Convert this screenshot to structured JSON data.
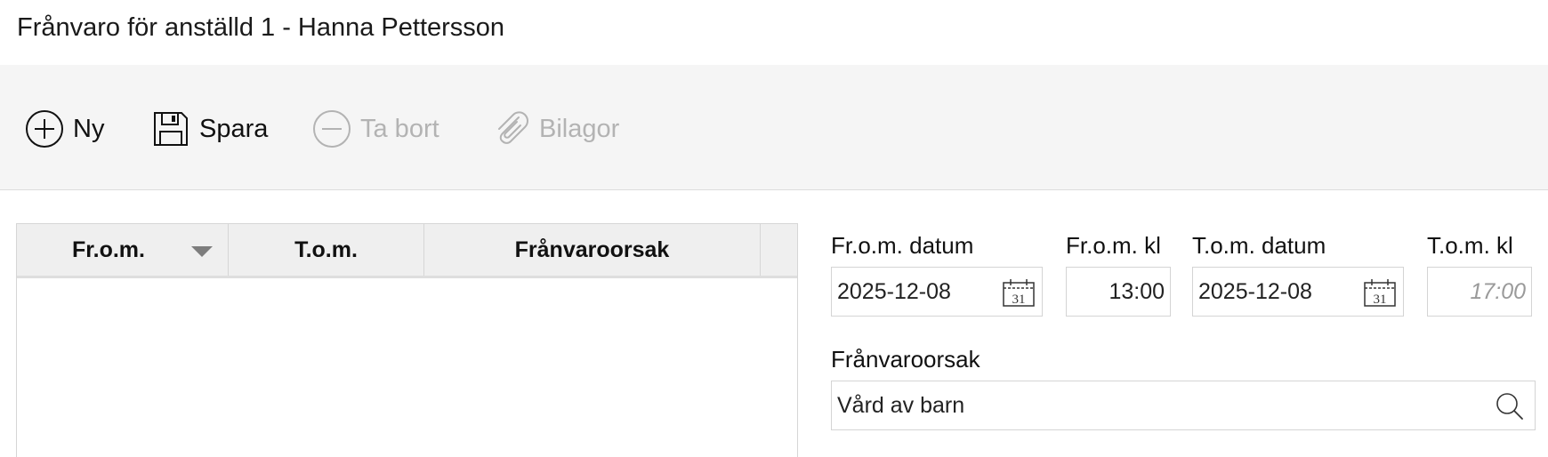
{
  "window": {
    "title": "Frånvaro för anställd 1 - Hanna Pettersson"
  },
  "toolbar": {
    "new_label": "Ny",
    "save_label": "Spara",
    "delete_label": "Ta bort",
    "attachments_label": "Bilagor",
    "delete_enabled": false,
    "attachments_enabled": false
  },
  "table": {
    "columns": [
      "Fr.o.m.",
      "T.o.m.",
      "Frånvaroorsak",
      ""
    ],
    "sorted_column": "Fr.o.m.",
    "sort_direction": "descending",
    "rows": []
  },
  "form": {
    "from_date": {
      "label": "Fr.o.m. datum",
      "value": "2025-12-08",
      "calendar_day": "31"
    },
    "from_time": {
      "label": "Fr.o.m. kl",
      "value": "13:00"
    },
    "to_date": {
      "label": "T.o.m. datum",
      "value": "2025-12-08",
      "calendar_day": "31"
    },
    "to_time": {
      "label": "T.o.m. kl",
      "value": "",
      "placeholder": "17:00"
    },
    "reason": {
      "label": "Frånvaroorsak",
      "value": "Vård av barn"
    }
  },
  "colors": {
    "toolbar_bg": "#f5f5f5",
    "header_bg": "#efefef",
    "disabled_text": "#b3b3b3",
    "border": "#d4d4d4"
  }
}
